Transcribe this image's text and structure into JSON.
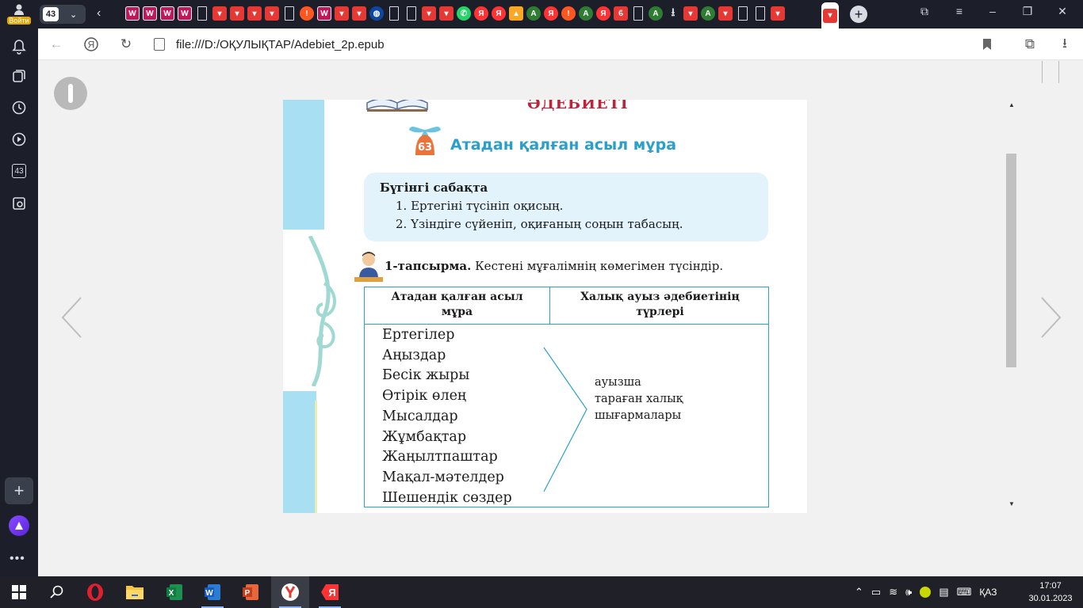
{
  "sidebar": {
    "login_label": "Войти",
    "tab_counter": "43"
  },
  "tabbar": {
    "tab_count": "43",
    "ya_glyph": "Я",
    "a_glyph": "A",
    "bang_glyph": "!"
  },
  "toolbar": {
    "url": "file:///D:/ОҚУЛЫҚТАР/Adebiet_2p.epub"
  },
  "page": {
    "section_title": "ӘДЕБИЕТІ",
    "lesson_number": "63",
    "lesson_title": "Атадан қалған асыл мұра",
    "goals_title": "Бүгінгі сабақта",
    "goals": [
      "1. Ертегіні түсініп оқисың.",
      "2. Үзіндіге сүйеніп, оқиғаның соңын табасың."
    ],
    "task_label": "1-тапсырма.",
    "task_text": "Кестені мұғалімнің көмегімен түсіндір.",
    "table": {
      "col1_header_line1": "Атадан қалған асыл",
      "col1_header_line2": "мұра",
      "col2_header_line1": "Халық ауыз әдебиетінің",
      "col2_header_line2": "түрлері",
      "genres": [
        "Ертегілер",
        "Аңыздар",
        "Бесік жыры",
        "Өтірік өлең",
        "Мысалдар",
        "Жұмбақтар",
        "Жаңылтпаштар",
        "Мақал-мәтелдер",
        "Шешендік сөздер"
      ],
      "result_line1": "ауызша",
      "result_line2": "тараған халық",
      "result_line3": "шығармалары"
    }
  },
  "taskbar": {
    "language": "ҚАЗ",
    "time": "17:07",
    "date": "30.01.2023",
    "ya_glyph": "Я"
  },
  "colors": {
    "title_red": "#c0223a",
    "lesson_blue": "#2a9fc9",
    "strip_blue": "#a8dff3",
    "goal_bg": "#e2f3fb",
    "table_border": "#2aa3c6"
  }
}
